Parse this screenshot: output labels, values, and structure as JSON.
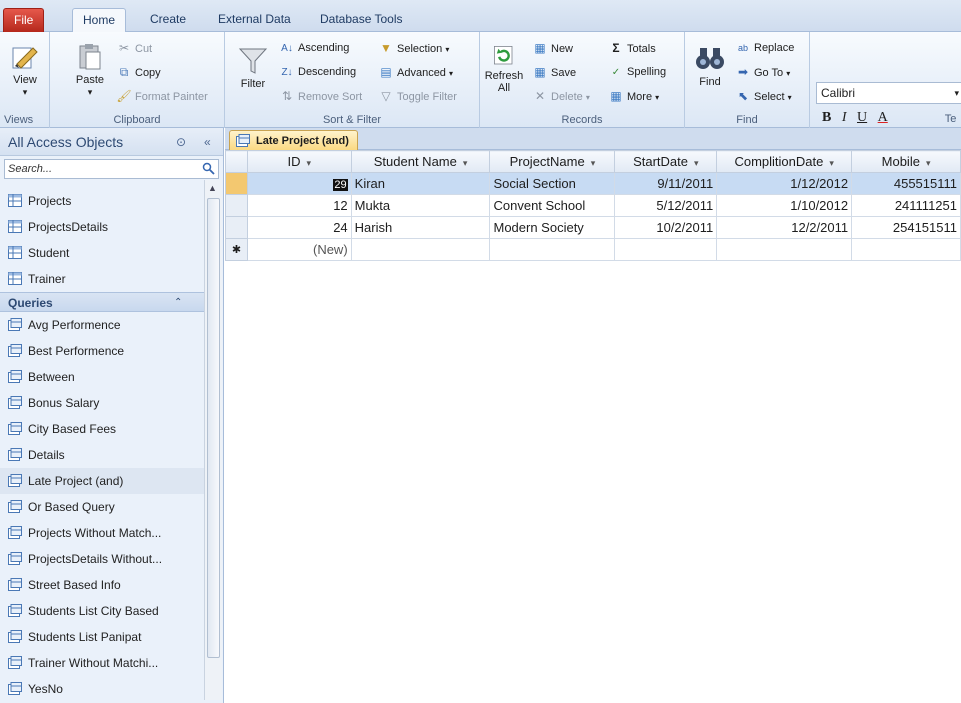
{
  "ribbon_tabs": [
    "File",
    "Home",
    "Create",
    "External Data",
    "Database Tools"
  ],
  "groups": {
    "views": {
      "label": "Views",
      "view": "View"
    },
    "clipboard": {
      "label": "Clipboard",
      "paste": "Paste",
      "cut": "Cut",
      "copy": "Copy",
      "format_painter": "Format Painter"
    },
    "sort_filter": {
      "label": "Sort & Filter",
      "filter": "Filter",
      "ascending": "Ascending",
      "descending": "Descending",
      "remove_sort": "Remove Sort",
      "selection": "Selection",
      "advanced": "Advanced",
      "toggle_filter": "Toggle Filter"
    },
    "records": {
      "label": "Records",
      "refresh_all": "Refresh All",
      "new": "New",
      "save": "Save",
      "delete": "Delete",
      "totals": "Totals",
      "spelling": "Spelling",
      "more": "More"
    },
    "find": {
      "label": "Find",
      "find": "Find",
      "replace": "Replace",
      "goto": "Go To",
      "select": "Select"
    },
    "text": {
      "font": "Calibri",
      "label_partial": "Te"
    }
  },
  "nav": {
    "title": "All Access Objects",
    "search_placeholder": "Search...",
    "tables": [
      "Projects",
      "ProjectsDetails",
      "Student",
      "Trainer"
    ],
    "queries_label": "Queries",
    "queries": [
      "Avg Performence",
      "Best Performence",
      "Between",
      "Bonus Salary",
      "City Based Fees",
      "Details",
      "Late Project (and)",
      "Or Based Query",
      "Projects Without Match...",
      "ProjectsDetails Without...",
      "Street Based Info",
      "Students List City Based",
      "Students List Panipat",
      "Trainer Without Matchi...",
      "YesNo"
    ],
    "selected_query": "Late Project (and)"
  },
  "doc": {
    "tab_title": "Late Project (and)",
    "columns": [
      "ID",
      "Student Name",
      "ProjectName",
      "StartDate",
      "ComplitionDate",
      "Mobile"
    ],
    "rows": [
      {
        "id": "29",
        "name": "Kiran",
        "project": "Social Section",
        "start": "9/11/2011",
        "end": "1/12/2012",
        "mobile": "455515111"
      },
      {
        "id": "12",
        "name": "Mukta",
        "project": "Convent School",
        "start": "5/12/2011",
        "end": "1/10/2012",
        "mobile": "241111251"
      },
      {
        "id": "24",
        "name": "Harish",
        "project": "Modern Society",
        "start": "10/2/2011",
        "end": "12/2/2011",
        "mobile": "254151511"
      }
    ],
    "new_row": "(New)"
  }
}
